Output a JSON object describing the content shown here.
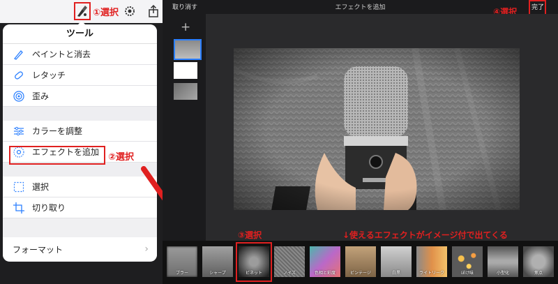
{
  "toolbar": {
    "callouts": {
      "step1": "①選択"
    }
  },
  "popover": {
    "title": "ツール",
    "group1": [
      "ペイントと消去",
      "レタッチ",
      "歪み"
    ],
    "group2": [
      "カラーを調整",
      "エフェクトを追加"
    ],
    "group3": [
      "選択",
      "切り取り"
    ],
    "format": "フォーマット",
    "callout_step2": "②選択"
  },
  "editor": {
    "undo_label": "取り消す",
    "title": "エフェクトを追加",
    "done_label": "完了",
    "callout_step4": "④選択",
    "add_page": "+",
    "callout_step3": "③選択",
    "callout_hint": "↓使えるエフェクトがイメージ付で出てくる",
    "effects": [
      "ブラー",
      "シャープ",
      "ビネット",
      "ノイズ",
      "色相と彩度",
      "ビンテージ",
      "白黒",
      "ライトリーク",
      "ぼけ味",
      "小型化",
      "焦点"
    ],
    "selected_effect": "ビネット"
  },
  "colors": {
    "annotation_red": "#e02020",
    "selection_blue": "#2a7fff"
  }
}
